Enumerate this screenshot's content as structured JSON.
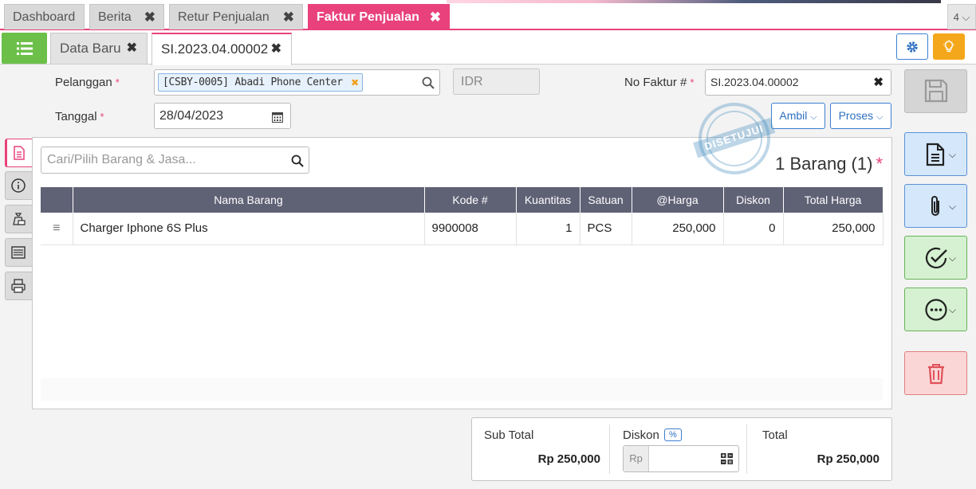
{
  "top_tabs": [
    {
      "label": "Dashboard"
    },
    {
      "label": "Berita"
    },
    {
      "label": "Retur Penjualan"
    },
    {
      "label": "Faktur Penjualan"
    }
  ],
  "tab_count": "4",
  "sub_tabs": [
    {
      "label": "Data Baru"
    },
    {
      "label": "SI.2023.04.00002"
    }
  ],
  "form": {
    "pelanggan_label": "Pelanggan",
    "pelanggan_value": "[CSBY-0005] Abadi Phone Center",
    "currency": "IDR",
    "tanggal_label": "Tanggal",
    "tanggal_value": "28/04/2023",
    "no_faktur_label": "No Faktur #",
    "no_faktur_value": "SI.2023.04.00002",
    "required_mark": "*",
    "ambil_label": "Ambil",
    "proses_label": "Proses"
  },
  "stamp_text": "DISETUJUI",
  "items_panel": {
    "search_placeholder": "Cari/Pilih Barang & Jasa...",
    "count_label": "1 Barang (1)",
    "required_mark": "*",
    "columns": [
      "Nama Barang",
      "Kode #",
      "Kuantitas",
      "Satuan",
      "@Harga",
      "Diskon",
      "Total Harga"
    ],
    "rows": [
      {
        "nama": "Charger Iphone 6S Plus",
        "kode": "9900008",
        "kuantitas": "1",
        "satuan": "PCS",
        "harga": "250,000",
        "diskon": "0",
        "total": "250,000"
      }
    ]
  },
  "totals": {
    "subtotal_label": "Sub Total",
    "subtotal_value": "Rp 250,000",
    "diskon_label": "Diskon",
    "diskon_pct": "%",
    "diskon_prefix": "Rp",
    "diskon_value": "",
    "total_label": "Total",
    "total_value": "Rp 250,000"
  },
  "colors": {
    "accent": "#e8417b",
    "menu_green": "#6cc04a",
    "header_dark": "#5f6175",
    "link_blue": "#2e6fc1"
  },
  "icons": [
    "list-icon",
    "gear-icon",
    "lightbulb-icon",
    "search-icon",
    "calendar-icon",
    "save-icon",
    "document-icon",
    "paperclip-icon",
    "check-circle-icon",
    "more-icon",
    "trash-icon"
  ]
}
